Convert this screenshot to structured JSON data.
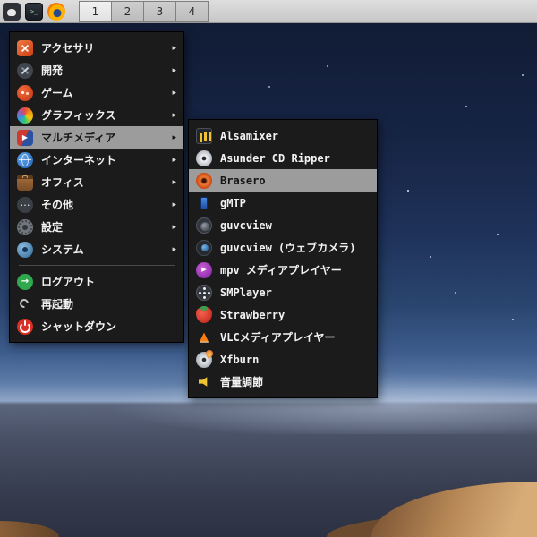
{
  "panel": {
    "workspaces": [
      {
        "label": "1",
        "active": true
      },
      {
        "label": "2",
        "active": false
      },
      {
        "label": "3",
        "active": false
      },
      {
        "label": "4",
        "active": false
      }
    ]
  },
  "menu": {
    "arrow": "▸",
    "categories": [
      {
        "label": "アクセサリ",
        "icon": "accessories-icon"
      },
      {
        "label": "開発",
        "icon": "development-icon"
      },
      {
        "label": "ゲーム",
        "icon": "games-icon"
      },
      {
        "label": "グラフィックス",
        "icon": "graphics-icon"
      },
      {
        "label": "マルチメディア",
        "icon": "multimedia-icon",
        "highlighted": true
      },
      {
        "label": "インターネット",
        "icon": "internet-icon"
      },
      {
        "label": "オフィス",
        "icon": "office-icon"
      },
      {
        "label": "その他",
        "icon": "other-icon"
      },
      {
        "label": "設定",
        "icon": "settings-icon"
      },
      {
        "label": "システム",
        "icon": "system-icon"
      }
    ],
    "actions": [
      {
        "label": "ログアウト",
        "icon": "logout-icon"
      },
      {
        "label": "再起動",
        "icon": "restart-icon"
      },
      {
        "label": "シャットダウン",
        "icon": "shutdown-icon"
      }
    ]
  },
  "submenu": {
    "items": [
      {
        "label": "Alsamixer",
        "icon": "alsamixer-icon"
      },
      {
        "label": "Asunder CD Ripper",
        "icon": "cd-ripper-icon"
      },
      {
        "label": "Brasero",
        "icon": "brasero-icon",
        "highlighted": true
      },
      {
        "label": "gMTP",
        "icon": "gmtp-icon"
      },
      {
        "label": "guvcview",
        "icon": "guvcview-icon"
      },
      {
        "label": "guvcview (ウェブカメラ)",
        "icon": "webcam-icon"
      },
      {
        "label": "mpv メディアプレイヤー",
        "icon": "mpv-icon"
      },
      {
        "label": "SMPlayer",
        "icon": "smplayer-icon"
      },
      {
        "label": "Strawberry",
        "icon": "strawberry-icon"
      },
      {
        "label": "VLCメディアプレイヤー",
        "icon": "vlc-icon"
      },
      {
        "label": "Xfburn",
        "icon": "xfburn-icon"
      },
      {
        "label": "音量調節",
        "icon": "volume-icon"
      }
    ]
  },
  "colors": {
    "menu_bg": "#1b1b1b",
    "highlight": "#9c9c9c",
    "panel_bg": "#cfcfcf",
    "menu_text": "#f2f2f2"
  }
}
